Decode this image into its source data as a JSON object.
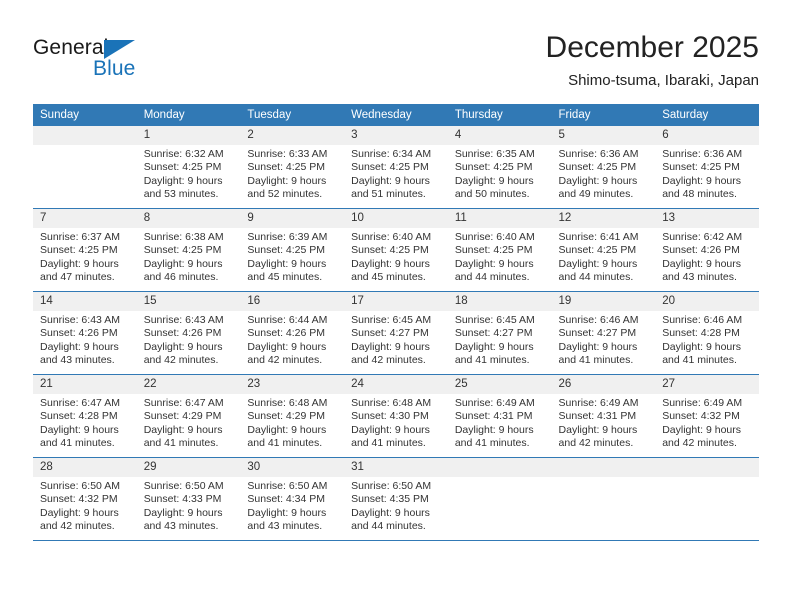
{
  "brand": {
    "name_dark": "General",
    "name_blue": "Blue",
    "accent_color": "#1a73b8"
  },
  "header": {
    "title": "December 2025",
    "subtitle": "Shimo-tsuma, Ibaraki, Japan"
  },
  "calendar": {
    "header_bg": "#3179b5",
    "datenum_bg": "#f0f0f0",
    "weekday_headers": [
      "Sunday",
      "Monday",
      "Tuesday",
      "Wednesday",
      "Thursday",
      "Friday",
      "Saturday"
    ],
    "weeks": [
      [
        {
          "day": "",
          "sunrise": "",
          "sunset": "",
          "daylight_1": "",
          "daylight_2": ""
        },
        {
          "day": "1",
          "sunrise": "Sunrise: 6:32 AM",
          "sunset": "Sunset: 4:25 PM",
          "daylight_1": "Daylight: 9 hours",
          "daylight_2": "and 53 minutes."
        },
        {
          "day": "2",
          "sunrise": "Sunrise: 6:33 AM",
          "sunset": "Sunset: 4:25 PM",
          "daylight_1": "Daylight: 9 hours",
          "daylight_2": "and 52 minutes."
        },
        {
          "day": "3",
          "sunrise": "Sunrise: 6:34 AM",
          "sunset": "Sunset: 4:25 PM",
          "daylight_1": "Daylight: 9 hours",
          "daylight_2": "and 51 minutes."
        },
        {
          "day": "4",
          "sunrise": "Sunrise: 6:35 AM",
          "sunset": "Sunset: 4:25 PM",
          "daylight_1": "Daylight: 9 hours",
          "daylight_2": "and 50 minutes."
        },
        {
          "day": "5",
          "sunrise": "Sunrise: 6:36 AM",
          "sunset": "Sunset: 4:25 PM",
          "daylight_1": "Daylight: 9 hours",
          "daylight_2": "and 49 minutes."
        },
        {
          "day": "6",
          "sunrise": "Sunrise: 6:36 AM",
          "sunset": "Sunset: 4:25 PM",
          "daylight_1": "Daylight: 9 hours",
          "daylight_2": "and 48 minutes."
        }
      ],
      [
        {
          "day": "7",
          "sunrise": "Sunrise: 6:37 AM",
          "sunset": "Sunset: 4:25 PM",
          "daylight_1": "Daylight: 9 hours",
          "daylight_2": "and 47 minutes."
        },
        {
          "day": "8",
          "sunrise": "Sunrise: 6:38 AM",
          "sunset": "Sunset: 4:25 PM",
          "daylight_1": "Daylight: 9 hours",
          "daylight_2": "and 46 minutes."
        },
        {
          "day": "9",
          "sunrise": "Sunrise: 6:39 AM",
          "sunset": "Sunset: 4:25 PM",
          "daylight_1": "Daylight: 9 hours",
          "daylight_2": "and 45 minutes."
        },
        {
          "day": "10",
          "sunrise": "Sunrise: 6:40 AM",
          "sunset": "Sunset: 4:25 PM",
          "daylight_1": "Daylight: 9 hours",
          "daylight_2": "and 45 minutes."
        },
        {
          "day": "11",
          "sunrise": "Sunrise: 6:40 AM",
          "sunset": "Sunset: 4:25 PM",
          "daylight_1": "Daylight: 9 hours",
          "daylight_2": "and 44 minutes."
        },
        {
          "day": "12",
          "sunrise": "Sunrise: 6:41 AM",
          "sunset": "Sunset: 4:25 PM",
          "daylight_1": "Daylight: 9 hours",
          "daylight_2": "and 44 minutes."
        },
        {
          "day": "13",
          "sunrise": "Sunrise: 6:42 AM",
          "sunset": "Sunset: 4:26 PM",
          "daylight_1": "Daylight: 9 hours",
          "daylight_2": "and 43 minutes."
        }
      ],
      [
        {
          "day": "14",
          "sunrise": "Sunrise: 6:43 AM",
          "sunset": "Sunset: 4:26 PM",
          "daylight_1": "Daylight: 9 hours",
          "daylight_2": "and 43 minutes."
        },
        {
          "day": "15",
          "sunrise": "Sunrise: 6:43 AM",
          "sunset": "Sunset: 4:26 PM",
          "daylight_1": "Daylight: 9 hours",
          "daylight_2": "and 42 minutes."
        },
        {
          "day": "16",
          "sunrise": "Sunrise: 6:44 AM",
          "sunset": "Sunset: 4:26 PM",
          "daylight_1": "Daylight: 9 hours",
          "daylight_2": "and 42 minutes."
        },
        {
          "day": "17",
          "sunrise": "Sunrise: 6:45 AM",
          "sunset": "Sunset: 4:27 PM",
          "daylight_1": "Daylight: 9 hours",
          "daylight_2": "and 42 minutes."
        },
        {
          "day": "18",
          "sunrise": "Sunrise: 6:45 AM",
          "sunset": "Sunset: 4:27 PM",
          "daylight_1": "Daylight: 9 hours",
          "daylight_2": "and 41 minutes."
        },
        {
          "day": "19",
          "sunrise": "Sunrise: 6:46 AM",
          "sunset": "Sunset: 4:27 PM",
          "daylight_1": "Daylight: 9 hours",
          "daylight_2": "and 41 minutes."
        },
        {
          "day": "20",
          "sunrise": "Sunrise: 6:46 AM",
          "sunset": "Sunset: 4:28 PM",
          "daylight_1": "Daylight: 9 hours",
          "daylight_2": "and 41 minutes."
        }
      ],
      [
        {
          "day": "21",
          "sunrise": "Sunrise: 6:47 AM",
          "sunset": "Sunset: 4:28 PM",
          "daylight_1": "Daylight: 9 hours",
          "daylight_2": "and 41 minutes."
        },
        {
          "day": "22",
          "sunrise": "Sunrise: 6:47 AM",
          "sunset": "Sunset: 4:29 PM",
          "daylight_1": "Daylight: 9 hours",
          "daylight_2": "and 41 minutes."
        },
        {
          "day": "23",
          "sunrise": "Sunrise: 6:48 AM",
          "sunset": "Sunset: 4:29 PM",
          "daylight_1": "Daylight: 9 hours",
          "daylight_2": "and 41 minutes."
        },
        {
          "day": "24",
          "sunrise": "Sunrise: 6:48 AM",
          "sunset": "Sunset: 4:30 PM",
          "daylight_1": "Daylight: 9 hours",
          "daylight_2": "and 41 minutes."
        },
        {
          "day": "25",
          "sunrise": "Sunrise: 6:49 AM",
          "sunset": "Sunset: 4:31 PM",
          "daylight_1": "Daylight: 9 hours",
          "daylight_2": "and 41 minutes."
        },
        {
          "day": "26",
          "sunrise": "Sunrise: 6:49 AM",
          "sunset": "Sunset: 4:31 PM",
          "daylight_1": "Daylight: 9 hours",
          "daylight_2": "and 42 minutes."
        },
        {
          "day": "27",
          "sunrise": "Sunrise: 6:49 AM",
          "sunset": "Sunset: 4:32 PM",
          "daylight_1": "Daylight: 9 hours",
          "daylight_2": "and 42 minutes."
        }
      ],
      [
        {
          "day": "28",
          "sunrise": "Sunrise: 6:50 AM",
          "sunset": "Sunset: 4:32 PM",
          "daylight_1": "Daylight: 9 hours",
          "daylight_2": "and 42 minutes."
        },
        {
          "day": "29",
          "sunrise": "Sunrise: 6:50 AM",
          "sunset": "Sunset: 4:33 PM",
          "daylight_1": "Daylight: 9 hours",
          "daylight_2": "and 43 minutes."
        },
        {
          "day": "30",
          "sunrise": "Sunrise: 6:50 AM",
          "sunset": "Sunset: 4:34 PM",
          "daylight_1": "Daylight: 9 hours",
          "daylight_2": "and 43 minutes."
        },
        {
          "day": "31",
          "sunrise": "Sunrise: 6:50 AM",
          "sunset": "Sunset: 4:35 PM",
          "daylight_1": "Daylight: 9 hours",
          "daylight_2": "and 44 minutes."
        },
        {
          "day": "",
          "sunrise": "",
          "sunset": "",
          "daylight_1": "",
          "daylight_2": ""
        },
        {
          "day": "",
          "sunrise": "",
          "sunset": "",
          "daylight_1": "",
          "daylight_2": ""
        },
        {
          "day": "",
          "sunrise": "",
          "sunset": "",
          "daylight_1": "",
          "daylight_2": ""
        }
      ]
    ]
  }
}
